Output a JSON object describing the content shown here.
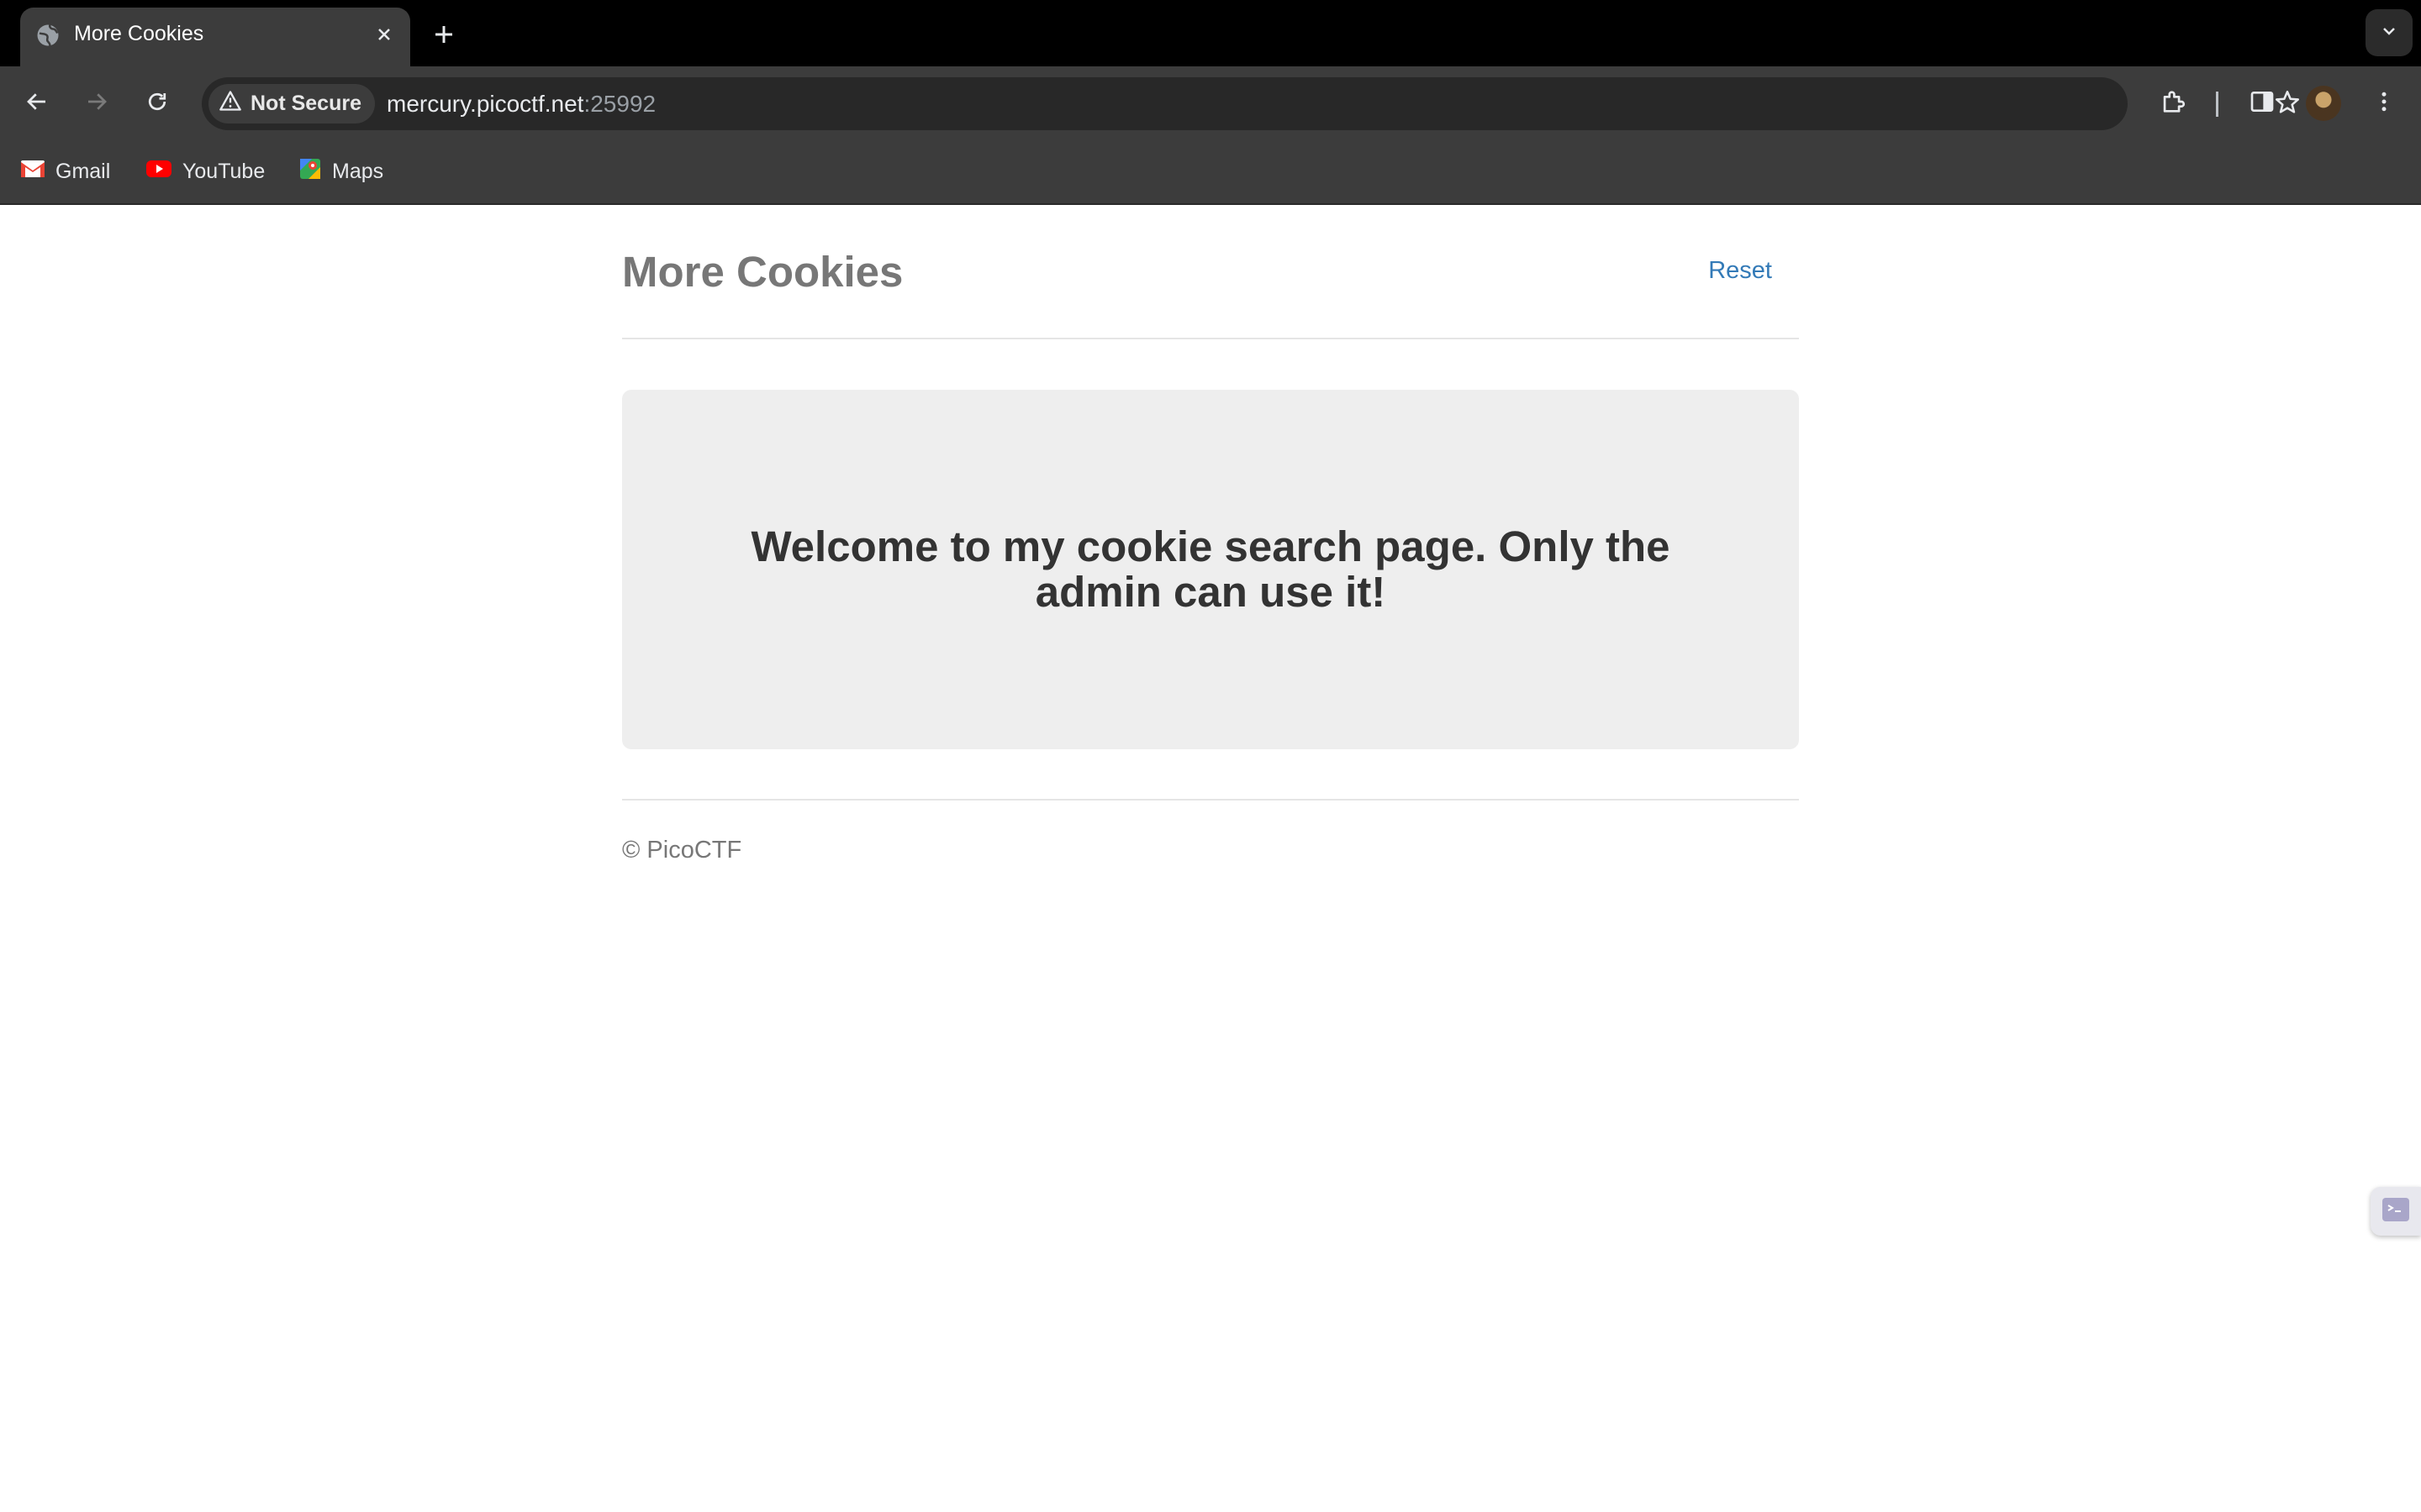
{
  "browser": {
    "tab_title": "More Cookies",
    "security_label": "Not Secure",
    "url_host": "mercury.picoctf.net",
    "url_port": ":25992",
    "bookmarks": [
      {
        "label": "Gmail",
        "icon": "gmail-icon"
      },
      {
        "label": "YouTube",
        "icon": "youtube-icon"
      },
      {
        "label": "Maps",
        "icon": "maps-icon"
      }
    ]
  },
  "page": {
    "site_title": "More Cookies",
    "reset_link": "Reset",
    "welcome_heading": "Welcome to my cookie search page. Only the admin can use it!",
    "footer": "© PicoCTF"
  },
  "colors": {
    "link": "#337ab7",
    "muted_text": "#777777",
    "jumbotron_bg": "#eeeeee"
  }
}
